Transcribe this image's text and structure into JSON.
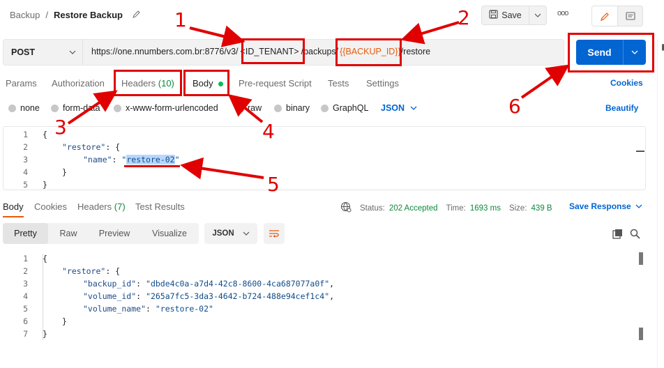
{
  "header": {
    "breadcrumb_parent": "Backup",
    "breadcrumb_sep": "/",
    "breadcrumb_current": "Restore Backup",
    "save_label": "Save",
    "more_label": "ooo"
  },
  "request": {
    "method": "POST",
    "url_prefix": "https://one.nnumbers.com.br:8776/v3/",
    "url_tenant": "<ID_TENANT>",
    "url_mid": "/backups/",
    "url_var": "{{BACKUP_ID}}",
    "url_suffix": "/restore",
    "send_label": "Send"
  },
  "req_tabs": {
    "params": "Params",
    "authorization": "Authorization",
    "headers_label": "Headers",
    "headers_count": "(10)",
    "body": "Body",
    "pre_request": "Pre-request Script",
    "tests": "Tests",
    "settings": "Settings",
    "cookies": "Cookies"
  },
  "body_types": {
    "none": "none",
    "form_data": "form-data",
    "urlencoded": "x-www-form-urlencoded",
    "raw": "raw",
    "binary": "binary",
    "graphql": "GraphQL",
    "format": "JSON",
    "beautify": "Beautify"
  },
  "request_body": {
    "line_numbers": [
      "1",
      "2",
      "3",
      "4",
      "5"
    ],
    "l1": "{",
    "l2_key": "\"restore\"",
    "l2_rest": ": {",
    "l3_key": "\"name\"",
    "l3_colon": ": ",
    "l3_q1": "\"",
    "l3_val": "restore-02",
    "l3_q2": "\"",
    "l4": "}",
    "l5": "}"
  },
  "resp_tabs": {
    "body": "Body",
    "cookies": "Cookies",
    "headers_label": "Headers",
    "headers_count": "(7)",
    "test_results": "Test Results"
  },
  "response_status": {
    "status_label": "Status:",
    "status_value": "202 Accepted",
    "time_label": "Time:",
    "time_value": "1693 ms",
    "size_label": "Size:",
    "size_value": "439 B",
    "save_response": "Save Response"
  },
  "view_modes": {
    "pretty": "Pretty",
    "raw": "Raw",
    "preview": "Preview",
    "visualize": "Visualize",
    "format": "JSON"
  },
  "response_body": {
    "line_numbers": [
      "1",
      "2",
      "3",
      "4",
      "5",
      "6",
      "7"
    ],
    "l1": "{",
    "l2_key": "\"restore\"",
    "l2_rest": ": {",
    "l3_key": "\"backup_id\"",
    "l3_val": "\"dbde4c0a-a7d4-42c8-8600-4ca687077a0f\"",
    "l4_key": "\"volume_id\"",
    "l4_val": "\"265a7fc5-3da3-4642-b724-488e94cef1c4\"",
    "l5_key": "\"volume_name\"",
    "l5_val": "\"restore-02\"",
    "l6": "}",
    "l7": "}"
  },
  "annotations": {
    "a1": "1",
    "a2": "2",
    "a3": "3",
    "a4": "4",
    "a5": "5",
    "a6": "6"
  },
  "colors": {
    "accent": "#0265d2",
    "orange": "#e8590c",
    "green": "#0cbb52",
    "status_green": "#0b8a3c",
    "annotation_red": "#e00000",
    "selection": "#b8d7ff"
  }
}
